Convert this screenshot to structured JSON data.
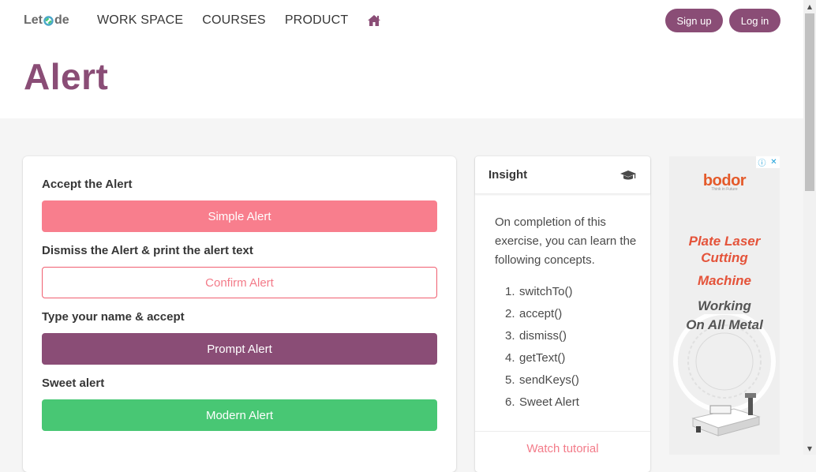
{
  "nav": {
    "logo_left": "Let",
    "logo_right": "de",
    "links": [
      "WORK SPACE",
      "COURSES",
      "PRODUCT"
    ],
    "home_icon": "home-icon",
    "signup": "Sign up",
    "login": "Log in"
  },
  "page": {
    "title": "Alert"
  },
  "alerts": {
    "accept_label": "Accept the Alert",
    "simple_button": "Simple Alert",
    "dismiss_label": "Dismiss the Alert & print the alert text",
    "confirm_button": "Confirm Alert",
    "prompt_label": "Type your name & accept",
    "prompt_button": "Prompt Alert",
    "sweet_label": "Sweet alert",
    "modern_button": "Modern Alert"
  },
  "insight": {
    "title": "Insight",
    "icon": "graduation-cap-icon",
    "text": "On completion of this exercise, you can learn the following concepts.",
    "concepts": [
      {
        "num": "1.",
        "label": "switchTo()"
      },
      {
        "num": "2.",
        "label": "accept()"
      },
      {
        "num": "3.",
        "label": "dismiss()"
      },
      {
        "num": "4.",
        "label": "getText()"
      },
      {
        "num": "5.",
        "label": "sendKeys()"
      },
      {
        "num": "6.",
        "label": "Sweet Alert"
      }
    ],
    "watch": "Watch tutorial"
  },
  "ad": {
    "brand": "bodor",
    "tagline": "Think in Future",
    "line1": "Plate Laser",
    "line2": "Cutting",
    "line3": "Machine",
    "line4": "Working",
    "line5": "On All Metal",
    "info_icon": "ⓘ",
    "close_icon": "✕"
  },
  "colors": {
    "brand": "#8a4d76",
    "simple": "#f87e8d",
    "confirm_border": "#f05f70",
    "modern": "#48c774",
    "link": "#f37b89"
  }
}
